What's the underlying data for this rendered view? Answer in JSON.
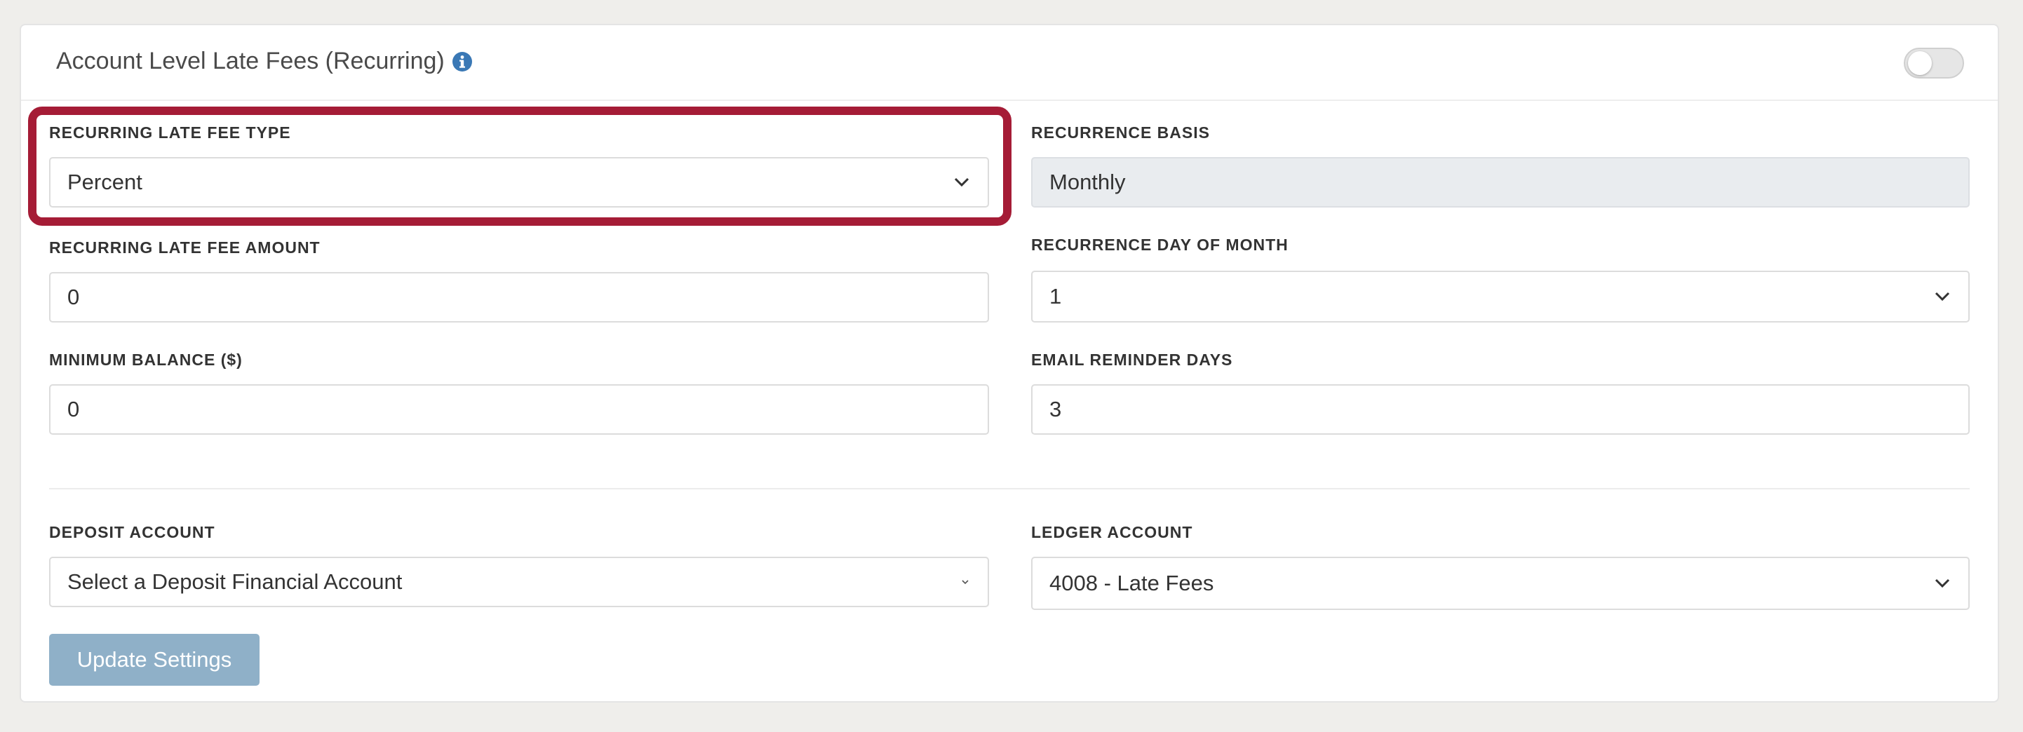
{
  "card": {
    "title": "Account Level Late Fees (Recurring)",
    "toggle_on": false
  },
  "fields": {
    "late_fee_type": {
      "label": "RECURRING LATE FEE TYPE",
      "value": "Percent"
    },
    "recurrence_basis": {
      "label": "RECURRENCE BASIS",
      "value": "Monthly"
    },
    "late_fee_amount": {
      "label": "RECURRING LATE FEE AMOUNT",
      "value": "0"
    },
    "recurrence_day": {
      "label": "RECURRENCE DAY OF MONTH",
      "value": "1"
    },
    "minimum_balance": {
      "label": "MINIMUM BALANCE ($)",
      "value": "0"
    },
    "email_reminder_days": {
      "label": "EMAIL REMINDER DAYS",
      "value": "3"
    },
    "deposit_account": {
      "label": "DEPOSIT ACCOUNT",
      "value": "Select a Deposit Financial Account"
    },
    "ledger_account": {
      "label": "LEDGER ACCOUNT",
      "value": "4008 - Late Fees"
    }
  },
  "actions": {
    "update_label": "Update Settings"
  },
  "colors": {
    "highlight": "#a51c36",
    "button": "#8fb0c8",
    "info_icon": "#3a78b5"
  },
  "icons": {
    "info": "info-circle-icon",
    "dropdown": "chevron-down-icon"
  }
}
